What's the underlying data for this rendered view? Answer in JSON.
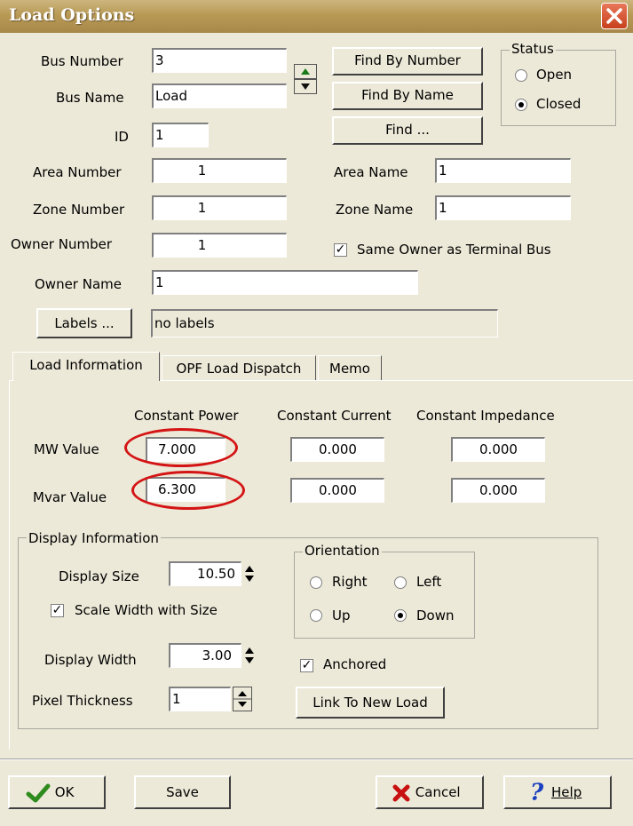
{
  "window": {
    "title": "Load Options"
  },
  "bus": {
    "number_label": "Bus Number",
    "number_value": "3",
    "name_label": "Bus Name",
    "name_value": "Load",
    "id_label": "ID",
    "id_value": "1"
  },
  "find_buttons": {
    "by_number": "Find By Number",
    "by_name": "Find By Name",
    "find": "Find ..."
  },
  "status": {
    "title": "Status",
    "options": [
      {
        "label": "Open",
        "selected": false
      },
      {
        "label": "Closed",
        "selected": true
      }
    ]
  },
  "area": {
    "number_label": "Area Number",
    "number_value": "1",
    "name_label": "Area Name",
    "name_value": "1"
  },
  "zone": {
    "number_label": "Zone Number",
    "number_value": "1",
    "name_label": "Zone Name",
    "name_value": "1"
  },
  "owner": {
    "number_label": "Owner Number",
    "number_value": "1",
    "same_owner_label": "Same Owner as Terminal Bus",
    "same_owner_checked": true,
    "name_label": "Owner Name",
    "name_value": "1"
  },
  "labels": {
    "button": "Labels ...",
    "value": "no labels"
  },
  "tabs": [
    {
      "label": "Load Information",
      "active": true
    },
    {
      "label": "OPF Load Dispatch",
      "active": false
    },
    {
      "label": "Memo",
      "active": false
    }
  ],
  "load_info": {
    "headers": {
      "constant_power": "Constant Power",
      "constant_current": "Constant Current",
      "constant_impedance": "Constant Impedance"
    },
    "mw_label": "MW Value",
    "mvar_label": "Mvar Value",
    "mw": {
      "power": "7.000",
      "current": "0.000",
      "impedance": "0.000"
    },
    "mvar": {
      "power": "6.300",
      "current": "0.000",
      "impedance": "0.000"
    }
  },
  "display": {
    "title": "Display Information",
    "size_label": "Display Size",
    "size_value": "10.50",
    "scale_width_label": "Scale Width with Size",
    "scale_width_checked": true,
    "width_label": "Display Width",
    "width_value": "3.00",
    "pixel_label": "Pixel Thickness",
    "pixel_value": "1",
    "orientation": {
      "title": "Orientation",
      "options": [
        {
          "label": "Right",
          "selected": false
        },
        {
          "label": "Left",
          "selected": false
        },
        {
          "label": "Up",
          "selected": false
        },
        {
          "label": "Down",
          "selected": true
        }
      ]
    },
    "anchored_label": "Anchored",
    "anchored_checked": true,
    "link_button": "Link To New Load"
  },
  "footer": {
    "ok": "OK",
    "save": "Save",
    "cancel": "Cancel",
    "help": "Help"
  },
  "colors": {
    "highlight_ellipse": "#d41414",
    "ok_check": "#2e8b1e",
    "cancel_x": "#c81010",
    "help_q": "#1a3fbf"
  }
}
